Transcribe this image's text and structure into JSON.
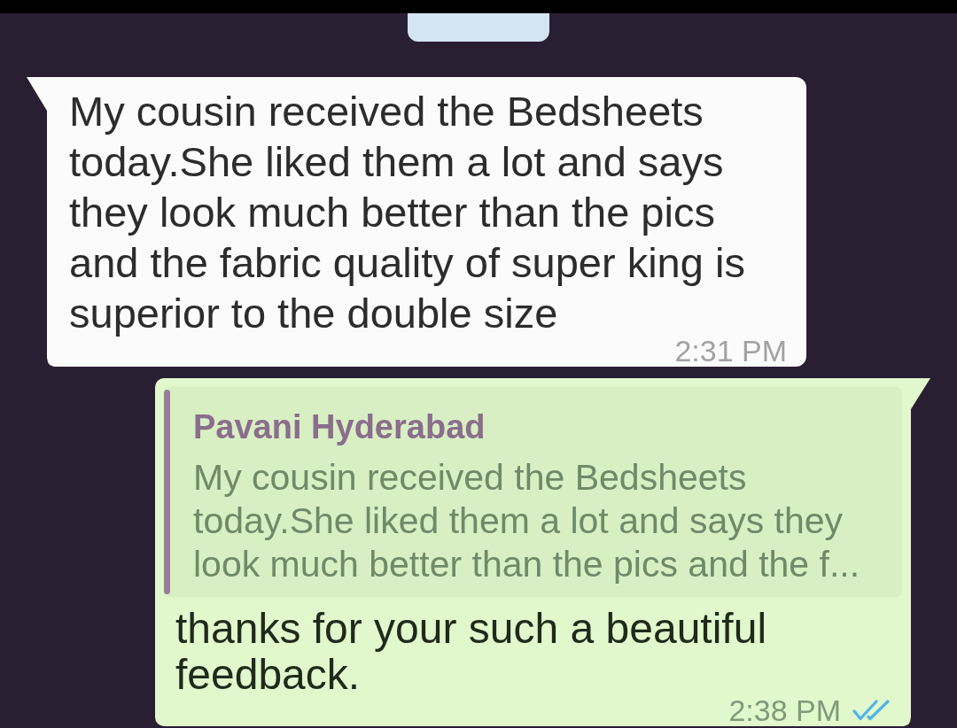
{
  "messages": [
    {
      "kind": "incoming",
      "text": "My cousin received the Bedsheets today.She liked them a lot and says they look much better than the pics and the fabric quality of super king is superior to the double size",
      "time": "2:31 PM"
    },
    {
      "kind": "outgoing",
      "quote": {
        "author": "Pavani Hyderabad",
        "text": "My cousin received the Bedsheets today.She liked them a lot and says they look much better than the pics and the f..."
      },
      "text": "thanks for your such a beautiful feedback.",
      "time": "2:38 PM",
      "read": true
    }
  ]
}
